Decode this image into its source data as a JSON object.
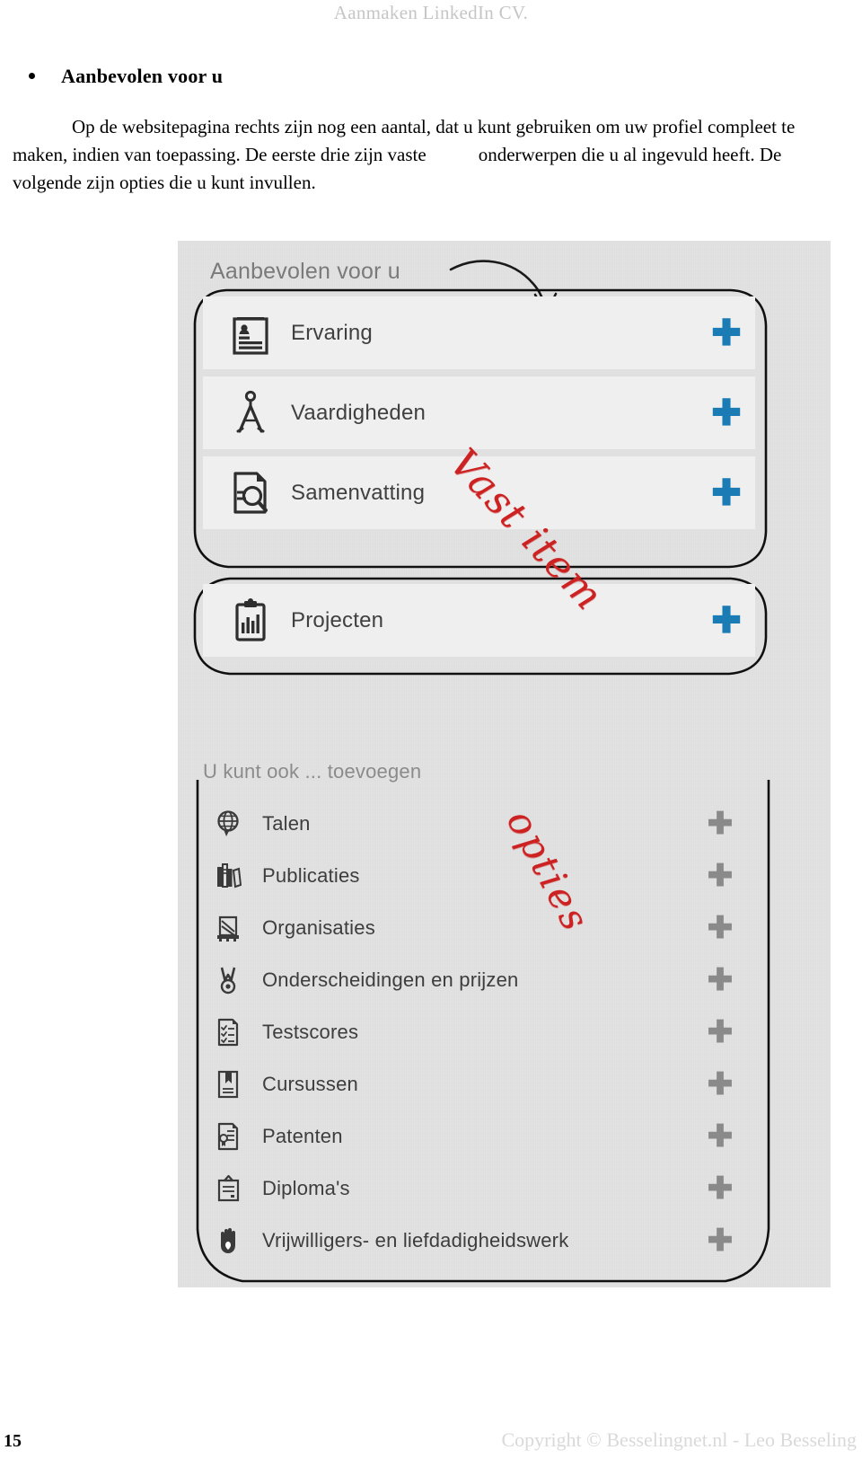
{
  "header": {
    "title": "Aanmaken LinkedIn CV."
  },
  "section": {
    "heading": "Aanbevolen voor u",
    "paragraph_line1": "Op de websitepagina rechts zijn nog een aantal, dat u kunt gebruiken om  uw profiel",
    "paragraph_line2a": "compleet te maken, indien van toepassing. De eerste drie zijn vaste",
    "paragraph_line2b": "onderwerpen die u",
    "paragraph_line3": "al ingevuld heeft. De volgende zijn opties die u kunt invullen."
  },
  "screenshot": {
    "title": "Aanbevolen voor u",
    "fixed_items": [
      {
        "label": "Ervaring",
        "icon": "resume-card-icon",
        "action": "add-plus-icon",
        "action_color": "#1b7bb5"
      },
      {
        "label": "Vaardigheden",
        "icon": "compass-icon",
        "action": "add-plus-icon",
        "action_color": "#1b7bb5"
      },
      {
        "label": "Samenvatting",
        "icon": "document-search-icon",
        "action": "add-plus-icon",
        "action_color": "#1b7bb5"
      }
    ],
    "project_items": [
      {
        "label": "Projecten",
        "icon": "clipboard-chart-icon",
        "action": "add-plus-icon",
        "action_color": "#1b7bb5"
      }
    ],
    "options_heading": "U kunt ook ... toevoegen",
    "option_items": [
      {
        "label": "Talen",
        "icon": "globe-icon",
        "action": "add-plus-icon",
        "action_color": "#8a8a8a"
      },
      {
        "label": "Publicaties",
        "icon": "books-icon",
        "action": "add-plus-icon",
        "action_color": "#8a8a8a"
      },
      {
        "label": "Organisaties",
        "icon": "organisation-building-icon",
        "action": "add-plus-icon",
        "action_color": "#8a8a8a"
      },
      {
        "label": "Onderscheidingen en prijzen",
        "icon": "medal-icon",
        "action": "add-plus-icon",
        "action_color": "#8a8a8a"
      },
      {
        "label": "Testscores",
        "icon": "checklist-icon",
        "action": "add-plus-icon",
        "action_color": "#8a8a8a"
      },
      {
        "label": "Cursussen",
        "icon": "book-bookmark-icon",
        "action": "add-plus-icon",
        "action_color": "#8a8a8a"
      },
      {
        "label": "Patenten",
        "icon": "patent-seal-icon",
        "action": "add-plus-icon",
        "action_color": "#8a8a8a"
      },
      {
        "label": "Diploma's",
        "icon": "certificate-icon",
        "action": "add-plus-icon",
        "action_color": "#8a8a8a"
      },
      {
        "label": "Vrijwilligers- en liefdadigheidswerk",
        "icon": "hand-icon",
        "action": "add-plus-icon",
        "action_color": "#8a8a8a"
      }
    ],
    "plus_glyph": "✚",
    "annotations": [
      {
        "text": "Vast item",
        "color": "#cc2222"
      },
      {
        "text": "opties",
        "color": "#cc2222"
      }
    ]
  },
  "footer": {
    "page_number": "15",
    "copyright": "Copyright © Besselingnet.nl -  Leo Besseling"
  }
}
